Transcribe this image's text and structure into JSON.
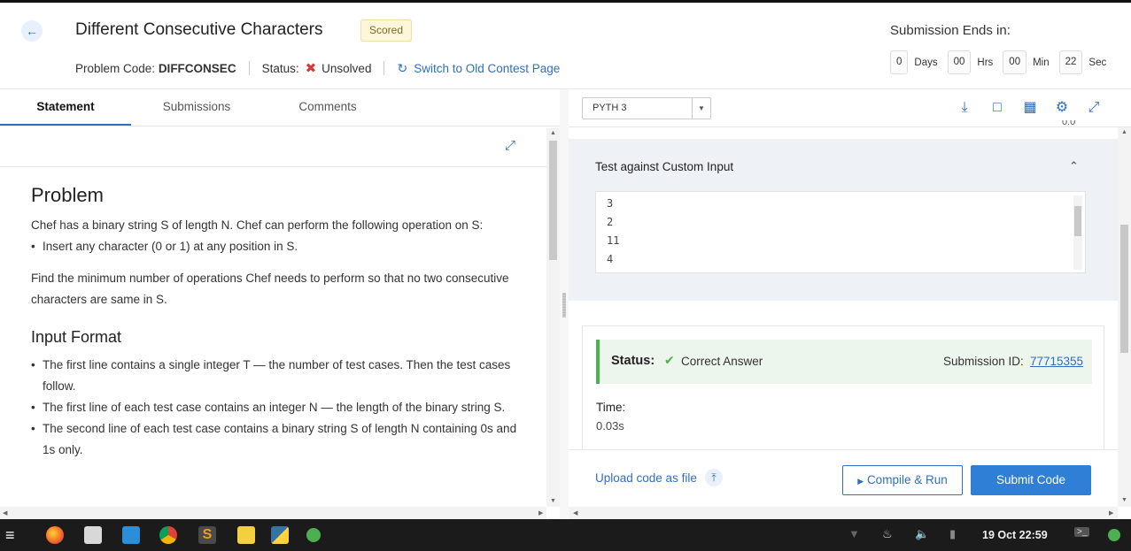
{
  "header": {
    "back_icon": "arrow-left-icon",
    "title": "Different Consecutive Characters",
    "badge": "Scored",
    "problem_code_label": "Problem Code:",
    "problem_code": "DIFFCONSEC",
    "status_label": "Status:",
    "status_value": "Unsolved",
    "switch_link": "Switch to Old Contest Page",
    "ends_label": "Submission Ends in:",
    "timer": {
      "days": "0",
      "days_label": "Days",
      "hrs": "00",
      "hrs_label": "Hrs",
      "min": "00",
      "min_label": "Min",
      "sec": "22",
      "sec_label": "Sec"
    }
  },
  "tabs": [
    {
      "label": "Statement",
      "active": true
    },
    {
      "label": "Submissions",
      "active": false
    },
    {
      "label": "Comments",
      "active": false
    }
  ],
  "statement": {
    "heading": "Problem",
    "intro": "Chef has a binary string S of length N. Chef can perform the following operation on S:",
    "op_item": "Insert any character (0 or 1) at any position in S.",
    "task": "Find the minimum number of operations Chef needs to perform so that no two consecutive characters are same in S.",
    "input_heading": "Input Format",
    "input_items": [
      "The first line contains a single integer T — the number of test cases. Then the test cases follow.",
      "The first line of each test case contains an integer N — the length of the binary string S.",
      "The second line of each test case contains a binary string S of length N containing 0s and 1s only."
    ]
  },
  "editor": {
    "language": "PYTH 3",
    "cut_text": "0.0",
    "custom_input_title": "Test against Custom Input",
    "custom_input_lines": [
      "3",
      "2",
      "11",
      "4"
    ],
    "status_label": "Status:",
    "status_value": "Correct Answer",
    "submission_label": "Submission ID:",
    "submission_id": "77715355",
    "time_label": "Time:",
    "time_value": "0.03s",
    "upload_label": "Upload code as file",
    "compile_label": "Compile & Run",
    "submit_label": "Submit Code"
  },
  "taskbar": {
    "clock": "19 Oct 22:59"
  },
  "colors": {
    "accent": "#2f6ec0",
    "success": "#4caf50",
    "error": "#d63a3a",
    "submit_bg": "#2f7fd6"
  }
}
